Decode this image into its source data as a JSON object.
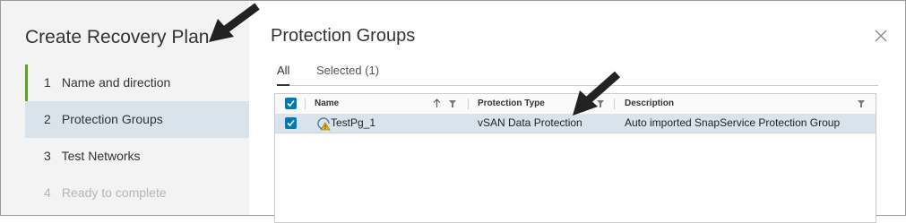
{
  "wizard": {
    "title": "Create Recovery Plan",
    "steps": [
      {
        "num": "1",
        "label": "Name and direction",
        "state": "done"
      },
      {
        "num": "2",
        "label": "Protection Groups",
        "state": "active"
      },
      {
        "num": "3",
        "label": "Test Networks",
        "state": "pending"
      },
      {
        "num": "4",
        "label": "Ready to complete",
        "state": "disabled"
      }
    ]
  },
  "page": {
    "title": "Protection Groups",
    "tabs": [
      {
        "label": "All",
        "active": true
      },
      {
        "label": "Selected (1)",
        "active": false
      }
    ]
  },
  "grid": {
    "columns": [
      {
        "label": "Name",
        "sort": "ascending",
        "filter": true
      },
      {
        "label": "Protection Type",
        "filter": true
      },
      {
        "label": "Description",
        "filter": true
      }
    ],
    "rows": [
      {
        "selected": true,
        "icon": "protection-group-warning-icon",
        "name": "TestPg_1",
        "type": "vSAN Data Protection",
        "description": "Auto imported SnapService Protection Group"
      }
    ]
  },
  "colors": {
    "accent": "#0079b8",
    "progress": "#5aa220",
    "selected_row": "#d8e3ec",
    "warning": "#f2b300"
  }
}
